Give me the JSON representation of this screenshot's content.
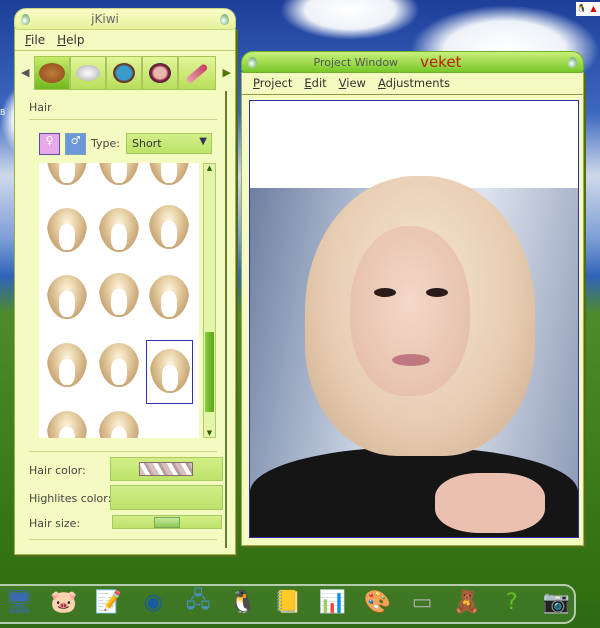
{
  "desktop": {
    "left_edge_glyph": "B"
  },
  "tray": {
    "icons": [
      "penguin-icon",
      "lock-icon"
    ]
  },
  "jkiwi": {
    "title": "jKiwi",
    "menu": [
      "File",
      "Help"
    ],
    "tools": [
      "hair-tool-icon",
      "cream-tool-icon",
      "eyeshadow-tool-icon",
      "blush-tool-icon",
      "lipstick-tool-icon"
    ],
    "section": "Hair",
    "type_label": "Type:",
    "type_value": "Short",
    "hair_color_label": "Hair color:",
    "highlites_label": "Highlites color:",
    "hair_size_label": "Hair size:",
    "hair_size_value": 0.5
  },
  "project": {
    "title": "Project Window",
    "brand": "veket",
    "menu": [
      "Project",
      "Edit",
      "View",
      "Adjustments"
    ]
  },
  "dock": {
    "items": [
      "monitor-icon",
      "pet-icon",
      "notepad-icon",
      "media-player-icon",
      "network-icon",
      "penguin-icon",
      "address-book-icon",
      "chart-icon",
      "paint-palette-icon",
      "usb-drive-icon",
      "photo-viewer-icon",
      "help-icon",
      "camera-icon"
    ]
  }
}
